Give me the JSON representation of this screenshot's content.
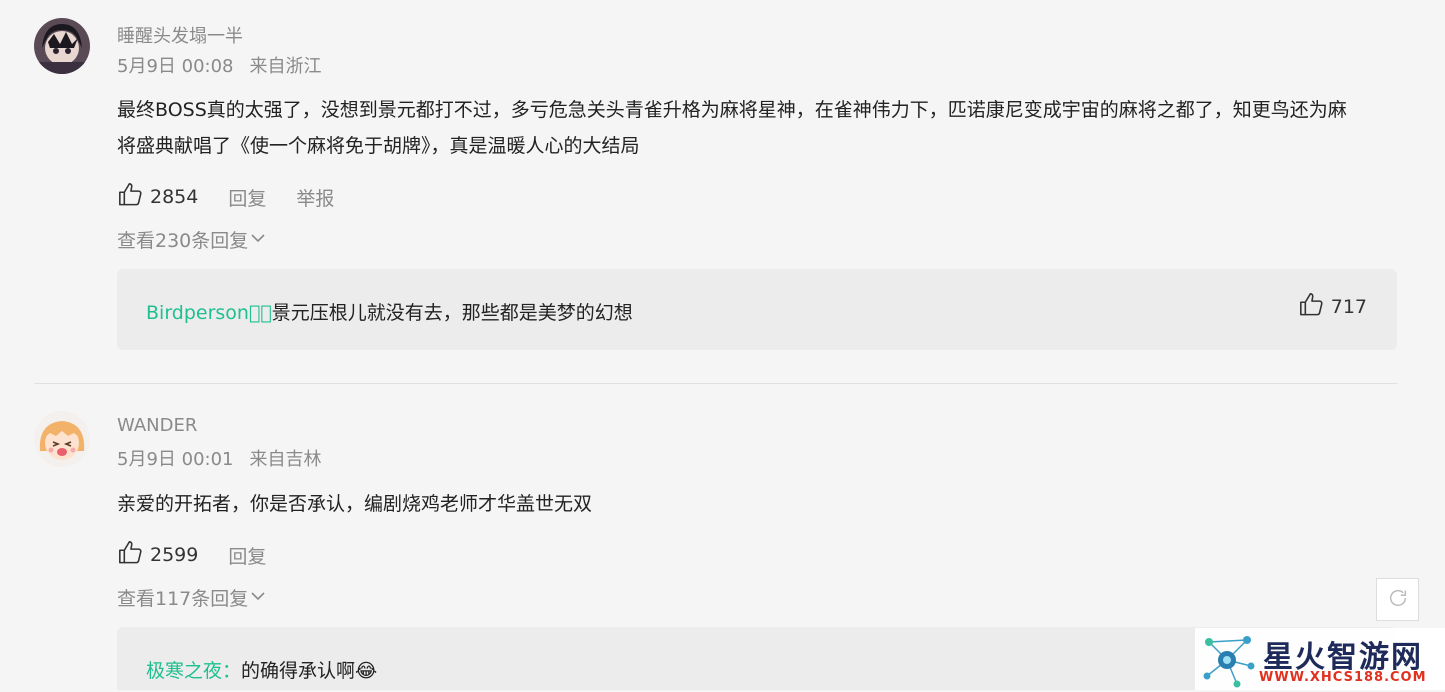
{
  "comments": [
    {
      "username": "睡醒头发塌一半",
      "date": "5月9日 00:08",
      "location": "来自浙江",
      "text_line1": "最终BOSS真的太强了，没想到景元都打不过，多亏危急关头青雀升格为麻将星神，在雀神伟力下，匹诺康尼变成宇宙的麻将之都了，知更鸟还为麻",
      "text_line2": "将盛典献唱了《使一个麻将免于胡牌》，真是温暖人心的大结局",
      "likes": "2854",
      "reply_label": "回复",
      "report_label": "举报",
      "view_replies": "查看230条回复",
      "reply": {
        "user": "Birdperson\u0000：",
        "text": "景元压根儿就没有去，那些都是美梦的幻想",
        "likes": "717"
      }
    },
    {
      "username": "WANDER",
      "date": "5月9日 00:01",
      "location": "来自吉林",
      "text_line1": "亲爱的开拓者，你是否承认，编剧烧鸡老师才华盖世无双",
      "likes": "2599",
      "reply_label": "回复",
      "view_replies": "查看117条回复",
      "reply": {
        "user": "极寒之夜：",
        "text": "的确得承认啊😂"
      }
    }
  ],
  "watermark": {
    "title": "星火智游网",
    "url": "WWW.XHCS188.COM"
  },
  "icons": {
    "like": "thumbs-up-icon",
    "chevron": "chevron-down-icon",
    "refresh": "refresh-icon"
  }
}
